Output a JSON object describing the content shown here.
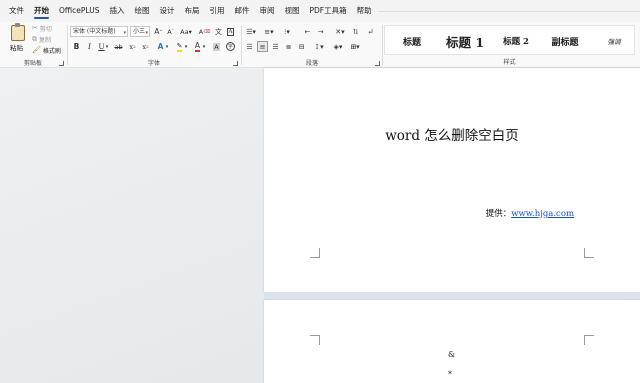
{
  "menu": {
    "items": [
      "文件",
      "开始",
      "OfficePLUS",
      "插入",
      "绘图",
      "设计",
      "布局",
      "引用",
      "邮件",
      "审阅",
      "视图",
      "PDF工具箱",
      "帮助"
    ],
    "active_index": 1
  },
  "clipboard": {
    "paste_label": "粘贴",
    "cut_label": "剪切",
    "copy_label": "复制",
    "format_painter_label": "格式刷",
    "group_label": "剪贴板"
  },
  "font": {
    "font_name": "宋体 (中文标题)",
    "font_size": "小三",
    "group_label": "字体"
  },
  "paragraph": {
    "group_label": "段落"
  },
  "styles": {
    "items": [
      "标题",
      "标题 1",
      "标题 2",
      "副标题",
      "强调"
    ],
    "group_label": "样式"
  },
  "document": {
    "title": "word 怎么删除空白页",
    "provider_label": "提供：",
    "provider_link": "www.hjga.com",
    "page2_marks": [
      "&",
      "*"
    ]
  },
  "colors": {
    "accent": "#2b579a",
    "link": "#1a4fc4",
    "highlight": "#ffd800",
    "font_color": "#d13438"
  }
}
